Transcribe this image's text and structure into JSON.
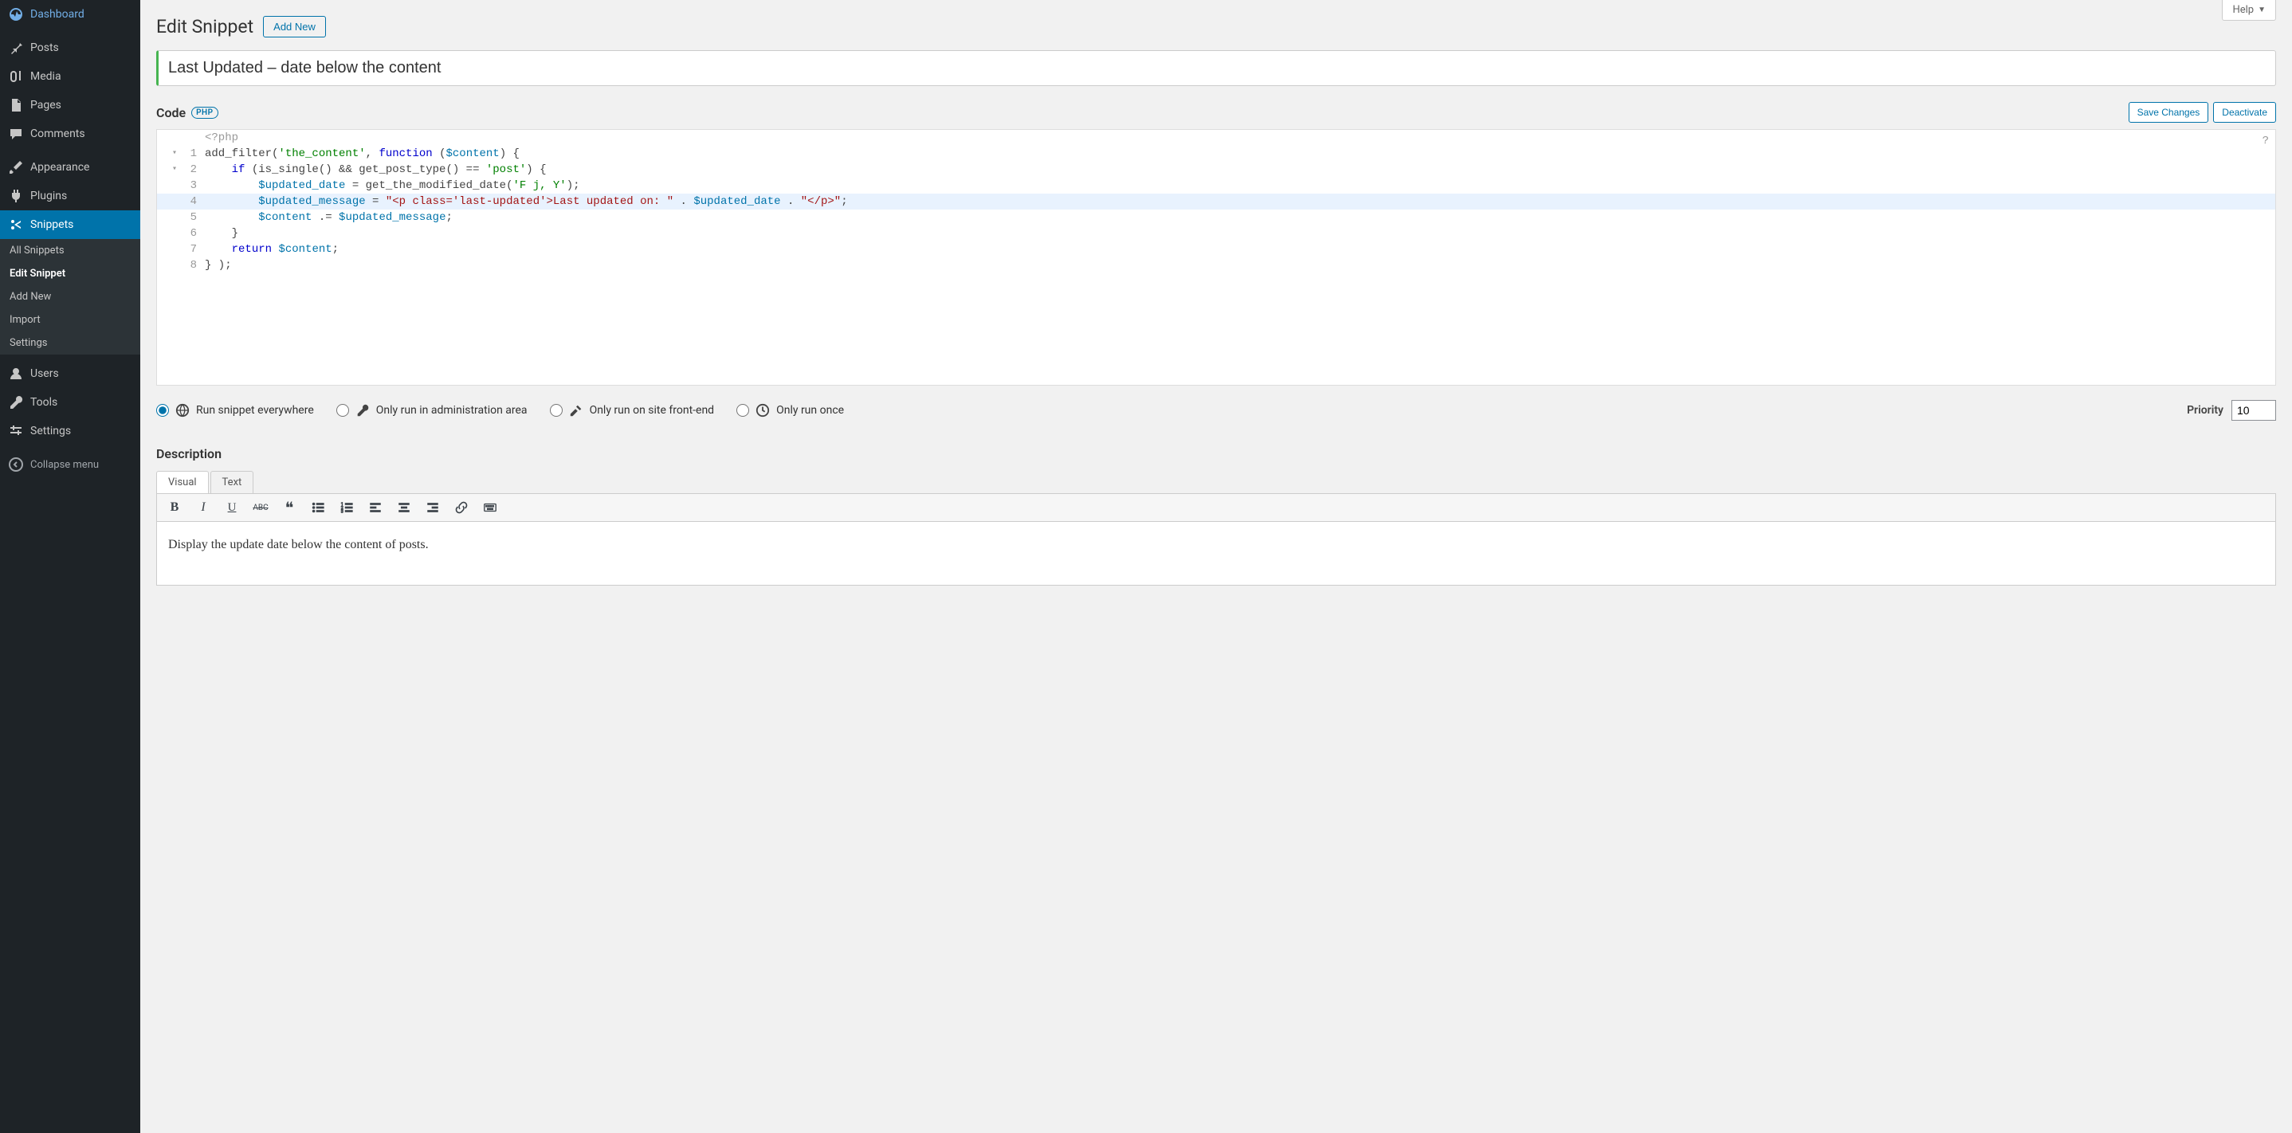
{
  "help_label": "Help",
  "sidebar": {
    "menu": {
      "dashboard": "Dashboard",
      "posts": "Posts",
      "media": "Media",
      "pages": "Pages",
      "comments": "Comments",
      "appearance": "Appearance",
      "plugins": "Plugins",
      "snippets": "Snippets",
      "users": "Users",
      "tools": "Tools",
      "settings": "Settings"
    },
    "submenu": {
      "all_snippets": "All Snippets",
      "edit_snippet": "Edit Snippet",
      "add_new": "Add New",
      "import": "Import",
      "settings": "Settings"
    },
    "collapse": "Collapse menu"
  },
  "heading": {
    "title": "Edit Snippet",
    "add_new": "Add New"
  },
  "snippet_title": "Last Updated – date below the content",
  "code": {
    "label": "Code",
    "badge": "PHP",
    "save": "Save Changes",
    "deactivate": "Deactivate",
    "php_open": "<?php",
    "lines": [
      {
        "n": "1",
        "fold": "▾",
        "raw": [
          "add_filter(",
          {
            "t": "str",
            "v": "'the_content'"
          },
          ", ",
          {
            "t": "kw",
            "v": "function"
          },
          " (",
          {
            "t": "var",
            "v": "$content"
          },
          ") {"
        ]
      },
      {
        "n": "2",
        "fold": "▾",
        "raw": [
          "    ",
          {
            "t": "kw",
            "v": "if"
          },
          " (is_single() && get_post_type() == ",
          {
            "t": "str",
            "v": "'post'"
          },
          ") {"
        ]
      },
      {
        "n": "3",
        "raw": [
          "        ",
          {
            "t": "var",
            "v": "$updated_date"
          },
          " = get_the_modified_date(",
          {
            "t": "str",
            "v": "'F j, Y'"
          },
          ");"
        ]
      },
      {
        "n": "4",
        "hl": true,
        "raw": [
          "        ",
          {
            "t": "var",
            "v": "$updated_message"
          },
          " = ",
          {
            "t": "html",
            "v": "\"<p class='last-updated'>Last updated on: \""
          },
          " . ",
          {
            "t": "var",
            "v": "$updated_date"
          },
          " . ",
          {
            "t": "html",
            "v": "\"</p>\""
          },
          ";"
        ]
      },
      {
        "n": "5",
        "raw": [
          "        ",
          {
            "t": "var",
            "v": "$content"
          },
          " .= ",
          {
            "t": "var",
            "v": "$updated_message"
          },
          ";"
        ]
      },
      {
        "n": "6",
        "raw": [
          "    }"
        ]
      },
      {
        "n": "7",
        "raw": [
          "    ",
          {
            "t": "kw",
            "v": "return"
          },
          " ",
          {
            "t": "var",
            "v": "$content"
          },
          ";"
        ]
      },
      {
        "n": "8",
        "raw": [
          "} );"
        ]
      }
    ]
  },
  "scope": {
    "everywhere": "Run snippet everywhere",
    "admin": "Only run in administration area",
    "frontend": "Only run on site front-end",
    "once": "Only run once",
    "selected": "everywhere"
  },
  "priority": {
    "label": "Priority",
    "value": "10"
  },
  "description": {
    "heading": "Description",
    "tabs": {
      "visual": "Visual",
      "text": "Text"
    },
    "content": "Display the update date below the content of posts."
  }
}
